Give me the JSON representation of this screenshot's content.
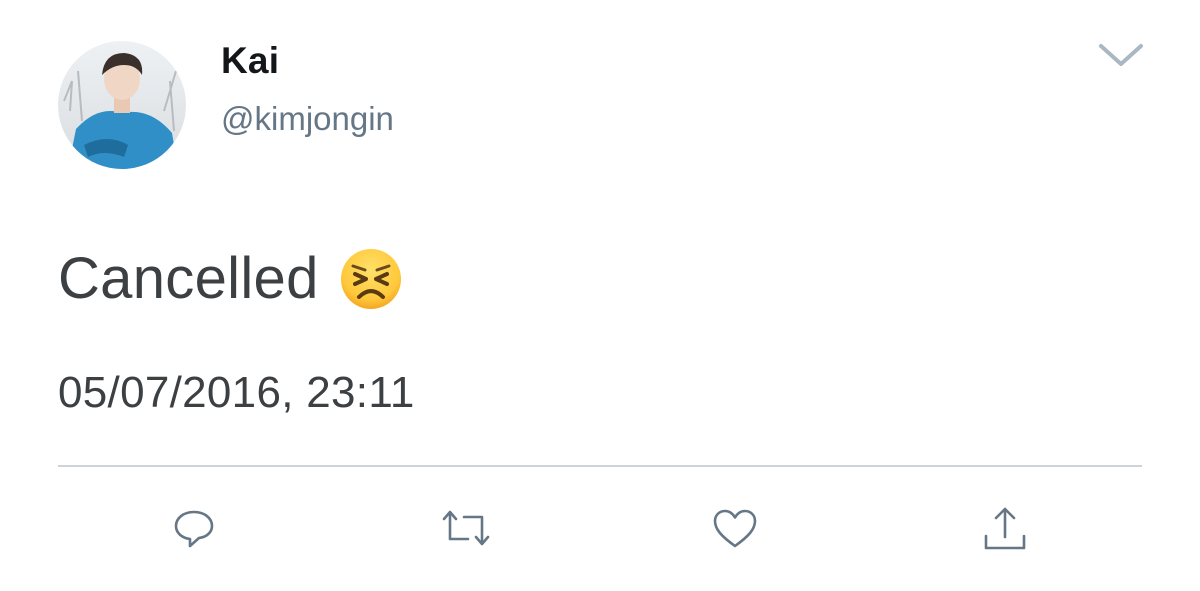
{
  "tweet": {
    "author": {
      "display_name": "Kai",
      "handle": "@kimjongin"
    },
    "text": "Cancelled",
    "emoji": "persevering-face",
    "timestamp": "05/07/2016, 23:11"
  },
  "icons": {
    "menu": "chevron-down-icon",
    "reply": "reply-icon",
    "retweet": "retweet-icon",
    "like": "heart-icon",
    "share": "share-icon"
  },
  "colors": {
    "name": "#14171a",
    "handle": "#657786",
    "body_text": "#3d4043",
    "icon": "#657786",
    "divider": "#cdd3d8"
  }
}
